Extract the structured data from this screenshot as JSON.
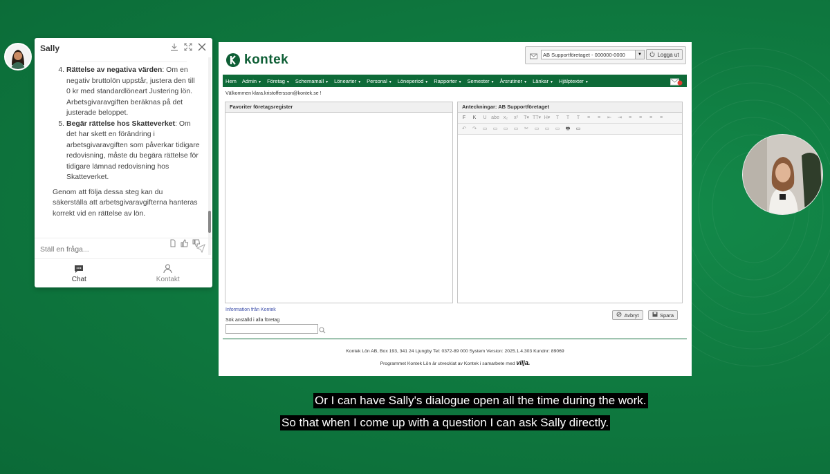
{
  "chat": {
    "title": "Sally",
    "list_items": [
      {
        "number": "4.",
        "heading": "Rättelse av negativa värden",
        "text": ": Om en negativ bruttolön uppstår, justera den till 0 kr med standardlöneart Justering lön. Arbetsgivaravgiften beräknas på det justerade beloppet."
      },
      {
        "number": "5.",
        "heading": "Begär rättelse hos Skatteverket",
        "text": ": Om det har skett en förändring i arbetsgivaravgiften som påverkar tidigare redovisning, måste du begära rättelse för tidigare lämnad redovisning hos Skatteverket."
      }
    ],
    "summary": "Genom att följa dessa steg kan du säkerställa att arbetsgivaravgifterna hanteras korrekt vid en rättelse av lön.",
    "input_placeholder": "Ställ en fråga...",
    "tabs": [
      {
        "label": "Chat",
        "icon": "chat-bubble-icon",
        "active": true
      },
      {
        "label": "Kontakt",
        "icon": "person-icon",
        "active": false
      }
    ]
  },
  "kontek": {
    "logo_text": "kontek",
    "company_select": "AB Supportföretaget - 000000-0000",
    "logout_label": "Logga ut",
    "nav": [
      "Hem",
      "Admin",
      "Företag",
      "Schemamall",
      "Lönearter",
      "Personal",
      "Löneperiod",
      "Rapporter",
      "Semester",
      "Årsrutiner",
      "Länkar",
      "Hjälptexter"
    ],
    "nav_has_caret": [
      false,
      true,
      true,
      true,
      true,
      true,
      true,
      true,
      true,
      true,
      true,
      true
    ],
    "welcome": "Välkommen klara.kristoffersson@kontek.se !",
    "favorites_title": "Favoriter företagsregister",
    "notes_title": "Anteckningar: AB Supportföretaget",
    "toolbar_row1": [
      "F",
      "K",
      "U",
      "abe",
      "x₂",
      "x²",
      "T▾",
      "TT▾",
      "H▾",
      "T",
      "T",
      "T",
      "≡",
      "≡",
      "⇤",
      "⇥",
      "≡",
      "≡",
      "≡",
      "≡"
    ],
    "toolbar_row2": [
      "↶",
      "↷",
      "▭",
      "▭",
      "▭",
      "▭",
      "✂",
      "▭",
      "▭",
      "▭",
      "🖶",
      "▭"
    ],
    "info_link": "Information från Kontek",
    "search_label": "Sök anställd i alla företag",
    "cancel_label": "Avbryt",
    "save_label": "Spara",
    "footer_line1": "Kontek Lön AB, Box 193, 341 24 Ljungby Tel: 0372-89 000 System Version: 2025.1.4.303 Kundnr: 89069",
    "footer_line2": "Programmet Kontek Lön är utvecklat av Kontek i samarbete med",
    "footer_brand": "vilja."
  },
  "captions": {
    "line1": "Or I can have Sally's dialogue open  all the time during the work.",
    "line2": "So that when I come up with a question I can ask Sally directly."
  },
  "colors": {
    "background": "#0f7a40",
    "kontek_green": "#0e6a38",
    "link_blue": "#3a4ca8"
  }
}
